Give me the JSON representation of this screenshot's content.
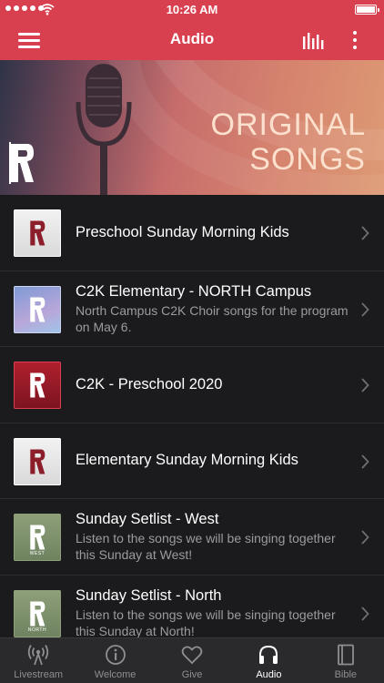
{
  "status_bar": {
    "time": "10:26 AM"
  },
  "nav": {
    "title": "Audio"
  },
  "hero": {
    "line1": "ORIGINAL",
    "line2": "SONGS"
  },
  "list": [
    {
      "title": "Preschool Sunday Morning Kids",
      "subtitle": "",
      "thumb": "white-r"
    },
    {
      "title": "C2K Elementary - NORTH Campus",
      "subtitle": "North Campus C2K Choir songs for the program on May 6.",
      "thumb": "blue-r"
    },
    {
      "title": "C2K - Preschool 2020",
      "subtitle": "",
      "thumb": "red-r"
    },
    {
      "title": "Elementary Sunday Morning Kids",
      "subtitle": "",
      "thumb": "white-r"
    },
    {
      "title": "Sunday Setlist - West",
      "subtitle": "Listen to the songs we will be singing together this Sunday at West!",
      "thumb": "green-r",
      "thumb_label": "WEST"
    },
    {
      "title": "Sunday Setlist - North",
      "subtitle": "Listen to the songs we will be singing together this Sunday at North!",
      "thumb": "green-r",
      "thumb_label": "NORTH"
    }
  ],
  "tabs": [
    {
      "label": "Livestream",
      "icon": "broadcast-icon",
      "active": false
    },
    {
      "label": "Welcome",
      "icon": "info-icon",
      "active": false
    },
    {
      "label": "Give",
      "icon": "heart-icon",
      "active": false
    },
    {
      "label": "Audio",
      "icon": "headphones-icon",
      "active": true
    },
    {
      "label": "Bible",
      "icon": "book-icon",
      "active": false
    }
  ],
  "colors": {
    "accent": "#d9404f",
    "background": "#1b1b1d",
    "tabbar": "#2a2a2d",
    "subtitle": "#9b9ba0"
  }
}
